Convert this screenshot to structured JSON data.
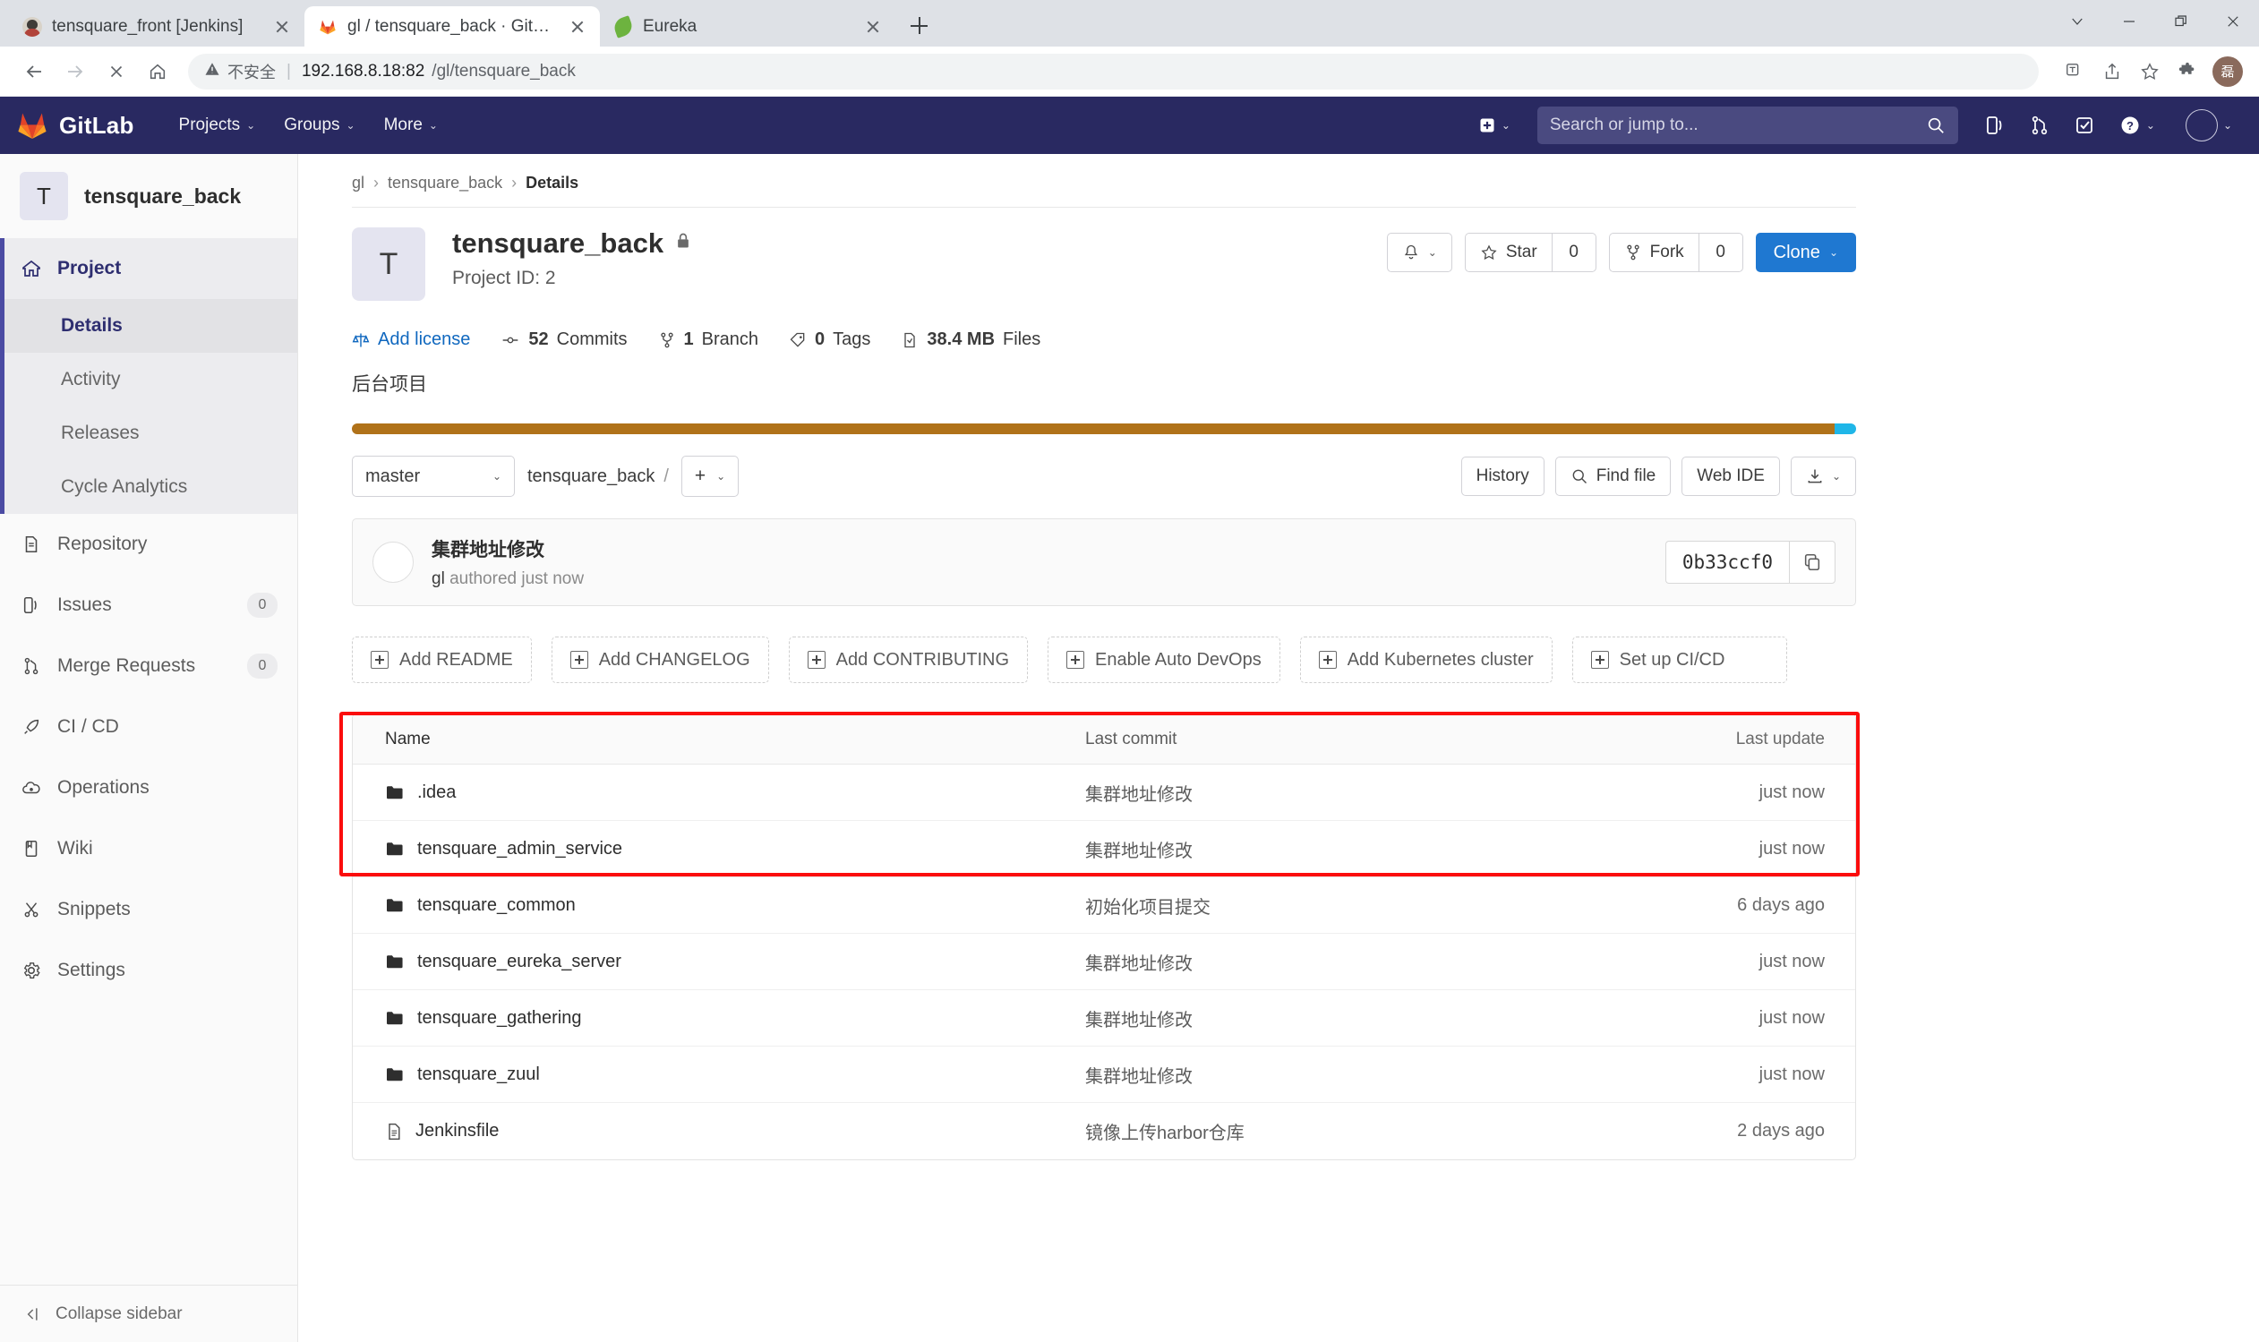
{
  "browser": {
    "tabs": [
      {
        "title": "tensquare_front [Jenkins]",
        "favicon": "jenkins-icon",
        "active": false
      },
      {
        "title": "gl / tensquare_back · GitLab",
        "favicon": "gitlab-icon",
        "active": true
      },
      {
        "title": "Eureka",
        "favicon": "spring-leaf-icon",
        "active": false
      }
    ],
    "new_tab_label": "+",
    "window_controls": [
      "chevron-down-icon",
      "minimize-icon",
      "restore-icon",
      "close-icon"
    ],
    "address": {
      "security_label": "不安全",
      "host": "192.168.8.18:82",
      "path": "/gl/tensquare_back",
      "full": "192.168.8.18:82/gl/tensquare_back"
    },
    "nav": {
      "back": "←",
      "forward": "→",
      "stop": "✕",
      "home": "⌂"
    },
    "toolbar_icons": [
      "translate-icon",
      "share-icon",
      "bookmark-star-icon",
      "extensions-puzzle-icon"
    ],
    "profile_initial": "磊"
  },
  "gitlab_nav": {
    "brand": "GitLab",
    "items": [
      {
        "label": "Projects",
        "caret": "⌄"
      },
      {
        "label": "Groups",
        "caret": "⌄"
      },
      {
        "label": "More",
        "caret": "⌄"
      }
    ],
    "search_placeholder": "Search or jump to...",
    "right_icons": [
      "plus-square-icon",
      "issues-icon",
      "merge-requests-icon",
      "todos-icon",
      "help-icon",
      "user-avatar"
    ]
  },
  "sidebar": {
    "project_initial": "T",
    "project_name": "tensquare_back",
    "top_item": {
      "label": "Project",
      "icon": "home-icon"
    },
    "sub_items": [
      {
        "label": "Details",
        "selected": true
      },
      {
        "label": "Activity",
        "selected": false
      },
      {
        "label": "Releases",
        "selected": false
      },
      {
        "label": "Cycle Analytics",
        "selected": false
      }
    ],
    "items": [
      {
        "label": "Repository",
        "icon": "document-icon",
        "badge": ""
      },
      {
        "label": "Issues",
        "icon": "issues-icon",
        "badge": "0"
      },
      {
        "label": "Merge Requests",
        "icon": "merge-requests-icon",
        "badge": "0"
      },
      {
        "label": "CI / CD",
        "icon": "rocket-icon",
        "badge": ""
      },
      {
        "label": "Operations",
        "icon": "cloud-gear-icon",
        "badge": ""
      },
      {
        "label": "Wiki",
        "icon": "book-icon",
        "badge": ""
      },
      {
        "label": "Snippets",
        "icon": "scissors-icon",
        "badge": ""
      },
      {
        "label": "Settings",
        "icon": "gear-icon",
        "badge": ""
      }
    ],
    "collapse_label": "Collapse sidebar"
  },
  "breadcrumb": {
    "group": "gl",
    "project": "tensquare_back",
    "current": "Details"
  },
  "project": {
    "initial": "T",
    "name": "tensquare_back",
    "visibility_icon": "lock-icon",
    "id_label": "Project ID: 2",
    "description": "后台项目",
    "stats": [
      {
        "icon": "scale-icon",
        "value": "",
        "label": "Add license",
        "link": true
      },
      {
        "icon": "commit-icon",
        "value": "52",
        "label": "Commits",
        "link": false
      },
      {
        "icon": "branch-icon",
        "value": "1",
        "label": "Branch",
        "link": false
      },
      {
        "icon": "tag-icon",
        "value": "0",
        "label": "Tags",
        "link": false
      },
      {
        "icon": "file-size-icon",
        "value": "38.4 MB",
        "label": "Files",
        "link": false
      }
    ],
    "actions": {
      "notification_icon": "bell-icon",
      "star_label": "Star",
      "star_count": "0",
      "fork_label": "Fork",
      "fork_count": "0",
      "clone_label": "Clone"
    },
    "language_bar": [
      {
        "color": "#b07219",
        "percent": 98.6
      },
      {
        "color": "#1fb6e8",
        "percent": 1.4
      }
    ]
  },
  "repo_toolbar": {
    "branch": "master",
    "path_root": "tensquare_back",
    "path_sep": "/",
    "add_label": "+",
    "history_label": "History",
    "find_file_label": "Find file",
    "web_ide_label": "Web IDE",
    "download_icon": "download-icon"
  },
  "last_commit": {
    "message": "集群地址修改",
    "author": "gl",
    "authored_text": "authored just now",
    "sha": "0b33ccf0",
    "copy_icon": "copy-icon"
  },
  "quick_actions": [
    "Add README",
    "Add CHANGELOG",
    "Add CONTRIBUTING",
    "Enable Auto DevOps",
    "Add Kubernetes cluster",
    "Set up CI/CD"
  ],
  "file_tree": {
    "headers": {
      "name": "Name",
      "last_commit": "Last commit",
      "last_update": "Last update"
    },
    "rows": [
      {
        "name": ".idea",
        "type": "folder",
        "commit": "集群地址修改",
        "update": "just now"
      },
      {
        "name": "tensquare_admin_service",
        "type": "folder",
        "commit": "集群地址修改",
        "update": "just now"
      },
      {
        "name": "tensquare_common",
        "type": "folder",
        "commit": "初始化项目提交",
        "update": "6 days ago"
      },
      {
        "name": "tensquare_eureka_server",
        "type": "folder",
        "commit": "集群地址修改",
        "update": "just now"
      },
      {
        "name": "tensquare_gathering",
        "type": "folder",
        "commit": "集群地址修改",
        "update": "just now"
      },
      {
        "name": "tensquare_zuul",
        "type": "folder",
        "commit": "集群地址修改",
        "update": "just now"
      },
      {
        "name": "Jenkinsfile",
        "type": "file",
        "commit": "镜像上传harbor仓库",
        "update": "2 days ago"
      }
    ]
  },
  "annotation": {
    "highlight_color": "#fb0d0d",
    "highlight_label": "highlighted-rows"
  }
}
